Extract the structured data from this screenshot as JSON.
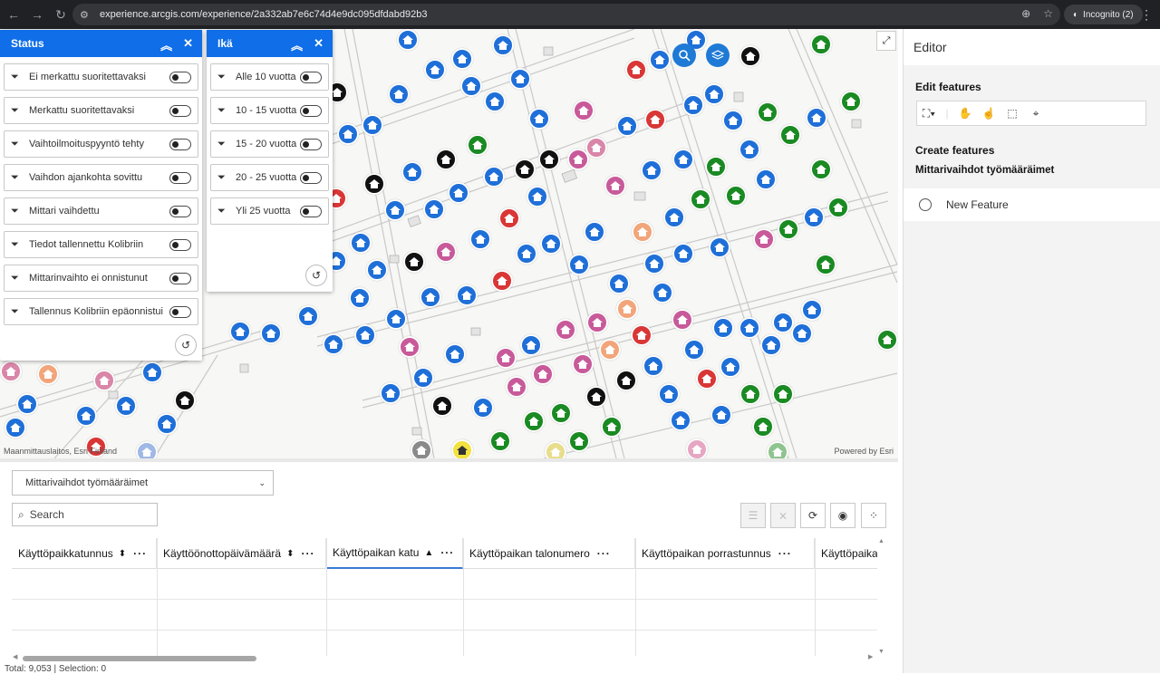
{
  "browser": {
    "url": "experience.arcgis.com/experience/2a332ab7e6c74d4e9dc095dfdabd92b3",
    "incognito_label": "Incognito (2)"
  },
  "map": {
    "attribution_left": "Maanmittauslaitos, Esri Finland",
    "attribution_right": "Powered by Esri",
    "marker_colors": {
      "blue": "#1f6fd8",
      "green": "#1a8a22",
      "black": "#111111",
      "red": "#d93636",
      "pink": "#c85a9a",
      "orange": "#f2a57a",
      "yellow": "#f2e240",
      "gray": "#8a8a8a"
    }
  },
  "status_panel": {
    "title": "Status",
    "filters": [
      {
        "label": "Ei merkattu suoritettavaksi",
        "on": false
      },
      {
        "label": "Merkattu suoritettavaksi",
        "on": false
      },
      {
        "label": "Vaihtoilmoituspyyntö tehty",
        "on": false
      },
      {
        "label": "Vaihdon ajankohta sovittu",
        "on": false
      },
      {
        "label": "Mittari vaihdettu",
        "on": false
      },
      {
        "label": "Tiedot tallennettu Kolibriin",
        "on": false
      },
      {
        "label": "Mittarinvaihto ei onnistunut",
        "on": false
      },
      {
        "label": "Tallennus Kolibriin epäonnistui",
        "on": false
      }
    ]
  },
  "age_panel": {
    "title": "Ikä",
    "filters": [
      {
        "label": "Alle 10 vuotta",
        "on": false
      },
      {
        "label": "10 - 15 vuotta",
        "on": false
      },
      {
        "label": "15 - 20 vuotta",
        "on": false
      },
      {
        "label": "20 - 25 vuotta",
        "on": false
      },
      {
        "label": "Yli 25 vuotta",
        "on": false
      }
    ]
  },
  "editor": {
    "title": "Editor",
    "edit_features": "Edit features",
    "create_features": "Create features",
    "layer_name": "Mittarivaihdot työmääräimet",
    "new_feature": "New Feature"
  },
  "table": {
    "layer_select": "Mittarivaihdot työmääräimet",
    "search_placeholder": "Search",
    "columns": [
      "Käyttöpaikkatunnus",
      "Käyttöönottopäivämäärä",
      "Käyttöpaikan katu",
      "Käyttöpaikan talonumero",
      "Käyttöpaikan porrastunnus",
      "Käyttöpaika"
    ],
    "status_text": "Total: 9,053 | Selection: 0"
  }
}
